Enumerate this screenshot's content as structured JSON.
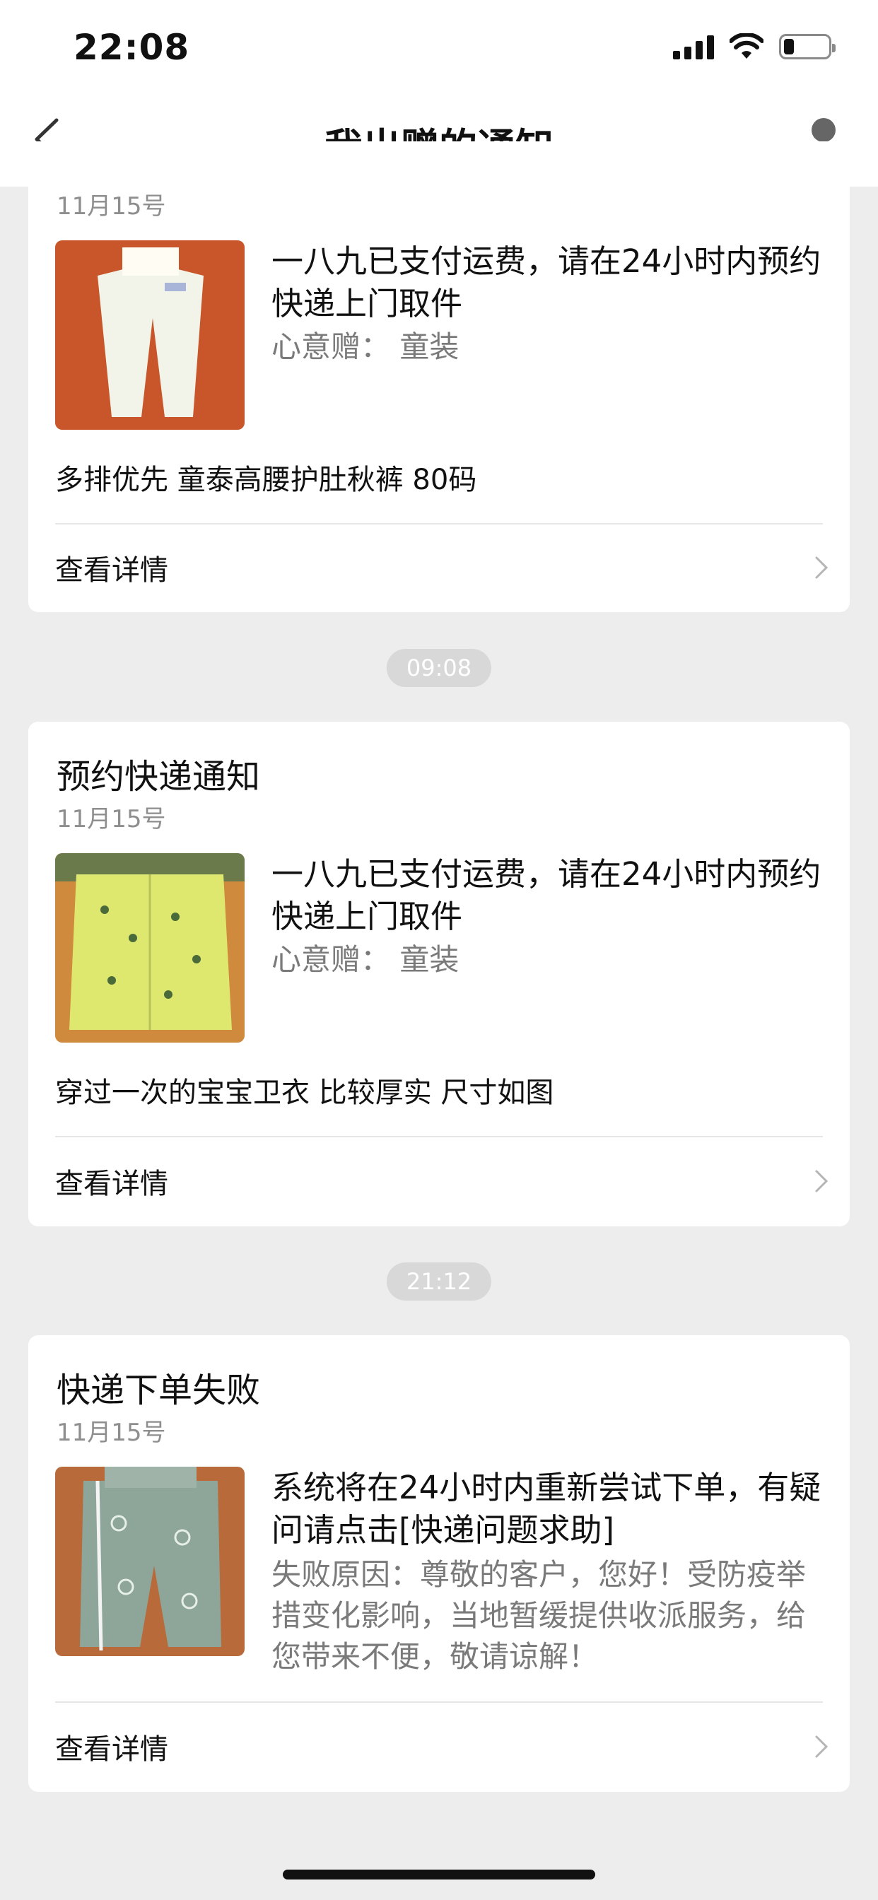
{
  "status_bar": {
    "time": "22:08",
    "icons": [
      "signal-icon",
      "wifi-icon",
      "battery-icon"
    ]
  },
  "nav": {
    "title": "我出赠的通知",
    "back_icon": "chevron-left-icon",
    "profile_icon": "user-icon"
  },
  "cards": [
    {
      "date": "11月15号",
      "message": "一八九已支付运费，请在24小时内预约快递上门取件",
      "subtext": "心意赠：  童装",
      "description": "多排优先 童泰高腰护肚秋裤 80码",
      "details_label": "查看详情"
    },
    {
      "title": "预约快递通知",
      "date": "11月15号",
      "message": "一八九已支付运费，请在24小时内预约快递上门取件",
      "subtext": "心意赠：  童装",
      "description": "穿过一次的宝宝卫衣 比较厚实 尺寸如图",
      "details_label": "查看详情"
    },
    {
      "title": "快递下单失败",
      "date": "11月15号",
      "message": "系统将在24小时内重新尝试下单，有疑问请点击[快递问题求助]",
      "subtext": "失败原因：尊敬的客户，您好！受防疫举措变化影响，当地暂缓提供收派服务，给您带来不便，敬请谅解！",
      "details_label": "查看详情"
    }
  ],
  "time_separators": [
    "09:08",
    "21:12"
  ],
  "colors": {
    "page_bg": "#ededed",
    "card_bg": "#ffffff",
    "muted_text": "#8e8e8e",
    "pill_bg": "#d8d8d8"
  }
}
